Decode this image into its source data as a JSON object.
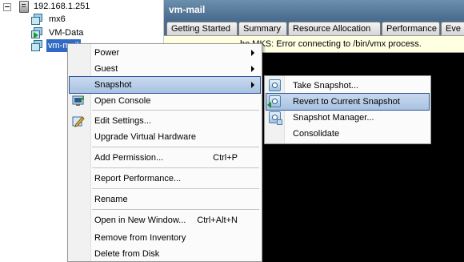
{
  "tree": {
    "host": "192.168.1.251",
    "vms": [
      "mx6",
      "VM-Data",
      "vm-mail"
    ]
  },
  "vm_panel": {
    "title": "vm-mail",
    "tabs": [
      "Getting Started",
      "Summary",
      "Resource Allocation",
      "Performance",
      "Eve"
    ],
    "status_text": "he MKS: Error connecting to /bin/vmx process."
  },
  "context_menu": {
    "power": "Power",
    "guest": "Guest",
    "snapshot": "Snapshot",
    "open_console": "Open Console",
    "edit_settings": "Edit Settings...",
    "upgrade_hw": "Upgrade Virtual Hardware",
    "add_permission": "Add Permission...",
    "add_permission_shortcut": "Ctrl+P",
    "report_performance": "Report Performance...",
    "rename": "Rename",
    "open_new_window": "Open in New Window...",
    "open_new_window_shortcut": "Ctrl+Alt+N",
    "remove_inventory": "Remove from Inventory",
    "delete_disk": "Delete from Disk"
  },
  "snapshot_menu": {
    "take": "Take Snapshot...",
    "revert": "Revert to Current Snapshot",
    "manager": "Snapshot Manager...",
    "consolidate": "Consolidate"
  }
}
